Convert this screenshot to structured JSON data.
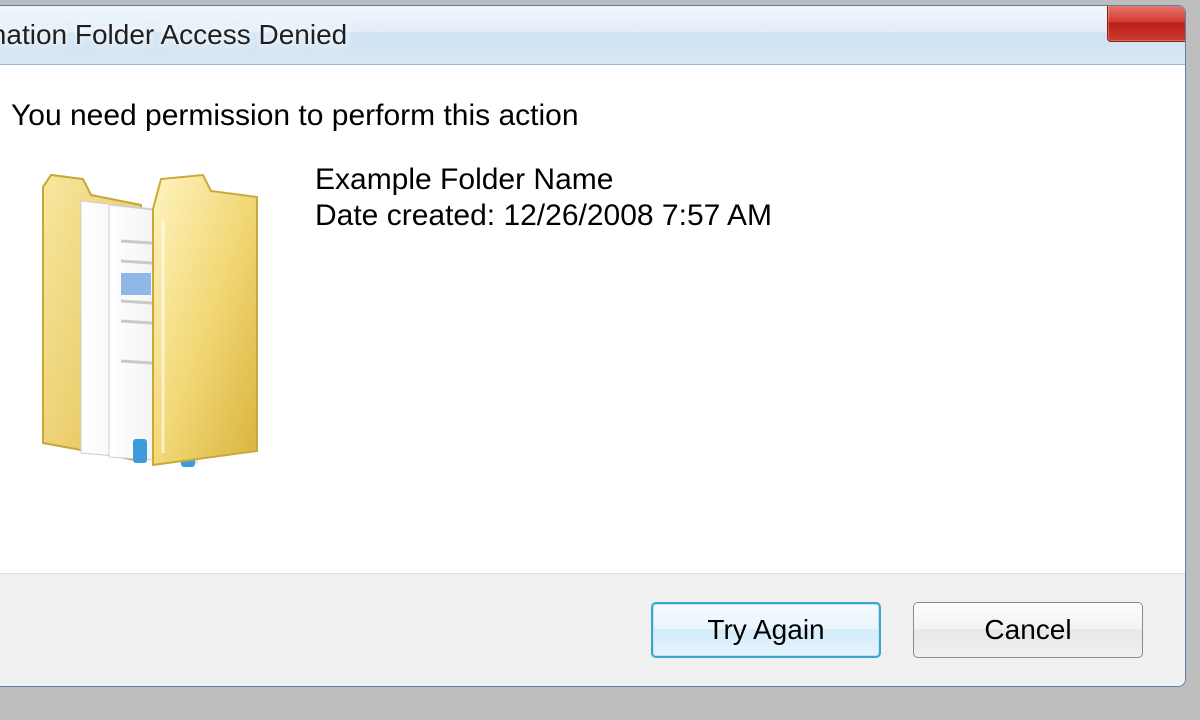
{
  "window": {
    "title": "Destination Folder Access Denied"
  },
  "message": "You need permission to perform this action",
  "folder": {
    "name": "Example Folder Name",
    "date_label": "Date created: 12/26/2008 7:57 AM"
  },
  "buttons": {
    "try_again": "Try Again",
    "cancel": "Cancel"
  },
  "icons": {
    "warning": "warning-icon",
    "folder": "folder-icon",
    "close": "close-icon"
  }
}
